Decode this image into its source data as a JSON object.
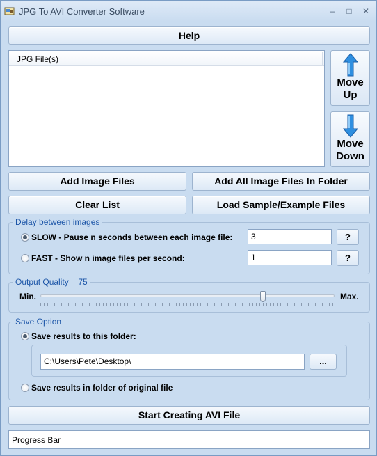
{
  "window": {
    "title": "JPG To AVI Converter Software",
    "minimize_label": "–",
    "maximize_label": "□",
    "close_label": "✕"
  },
  "help_button": "Help",
  "file_list": {
    "column_header": "JPG File(s)",
    "items": []
  },
  "move_up": {
    "line1": "Move",
    "line2": "Up"
  },
  "move_down": {
    "line1": "Move",
    "line2": "Down"
  },
  "buttons": {
    "add_image_files": "Add Image Files",
    "add_all_in_folder": "Add All Image Files In Folder",
    "clear_list": "Clear List",
    "load_sample": "Load Sample/Example Files"
  },
  "delay": {
    "title": "Delay between images",
    "slow_label": "SLOW",
    "slow_desc": " - Pause n seconds between each image file:",
    "slow_value": "3",
    "slow_selected": true,
    "fast_label": "FAST",
    "fast_desc": " - Show n image files per second:",
    "fast_value": "1",
    "fast_selected": false,
    "help_label": "?"
  },
  "quality": {
    "title": "Output Quality = 75",
    "min_label": "Min.",
    "max_label": "Max.",
    "value": 75
  },
  "save": {
    "title": "Save Option",
    "to_folder_label": "Save results to this folder:",
    "to_folder_selected": true,
    "folder_path": "C:\\Users\\Pete\\Desktop\\",
    "browse_label": "...",
    "original_folder_label": "Save results in folder of original file",
    "original_folder_selected": false
  },
  "start_button": "Start Creating AVI File",
  "progress": {
    "label": "Progress Bar",
    "percent": 0
  },
  "colors": {
    "window_bg": "#c9dcf0",
    "group_title": "#1d56a8",
    "arrow": "#2f8fe0"
  }
}
